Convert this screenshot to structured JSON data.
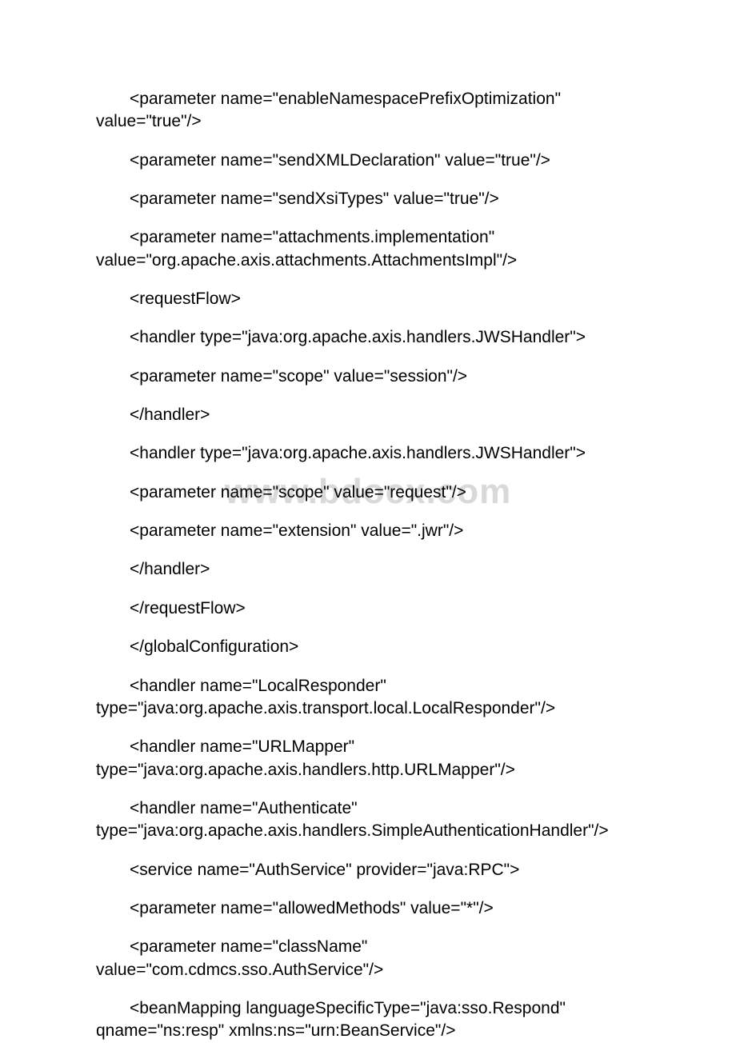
{
  "watermark": "www.bdocx.com",
  "lines": [
    "<parameter name=\"enableNamespacePrefixOptimization\" value=\"true\"/>",
    "<parameter name=\"sendXMLDeclaration\" value=\"true\"/>",
    "<parameter name=\"sendXsiTypes\" value=\"true\"/>",
    "<parameter name=\"attachments.implementation\" value=\"org.apache.axis.attachments.AttachmentsImpl\"/>",
    "<requestFlow>",
    "<handler type=\"java:org.apache.axis.handlers.JWSHandler\">",
    "<parameter name=\"scope\" value=\"session\"/>",
    "</handler>",
    "<handler type=\"java:org.apache.axis.handlers.JWSHandler\">",
    "<parameter name=\"scope\" value=\"request\"/>",
    "<parameter name=\"extension\" value=\".jwr\"/>",
    "</handler>",
    "</requestFlow>",
    "</globalConfiguration>",
    "<handler name=\"LocalResponder\" type=\"java:org.apache.axis.transport.local.LocalResponder\"/>",
    "<handler name=\"URLMapper\" type=\"java:org.apache.axis.handlers.http.URLMapper\"/>",
    "<handler name=\"Authenticate\" type=\"java:org.apache.axis.handlers.SimpleAuthenticationHandler\"/>",
    "<service name=\"AuthService\" provider=\"java:RPC\">",
    "<parameter name=\"allowedMethods\" value=\"*\"/>",
    "<parameter name=\"className\" value=\"com.cdmcs.sso.AuthService\"/>",
    "<beanMapping languageSpecificType=\"java:sso.Respond\" qname=\"ns:resp\" xmlns:ns=\"urn:BeanService\"/>"
  ]
}
